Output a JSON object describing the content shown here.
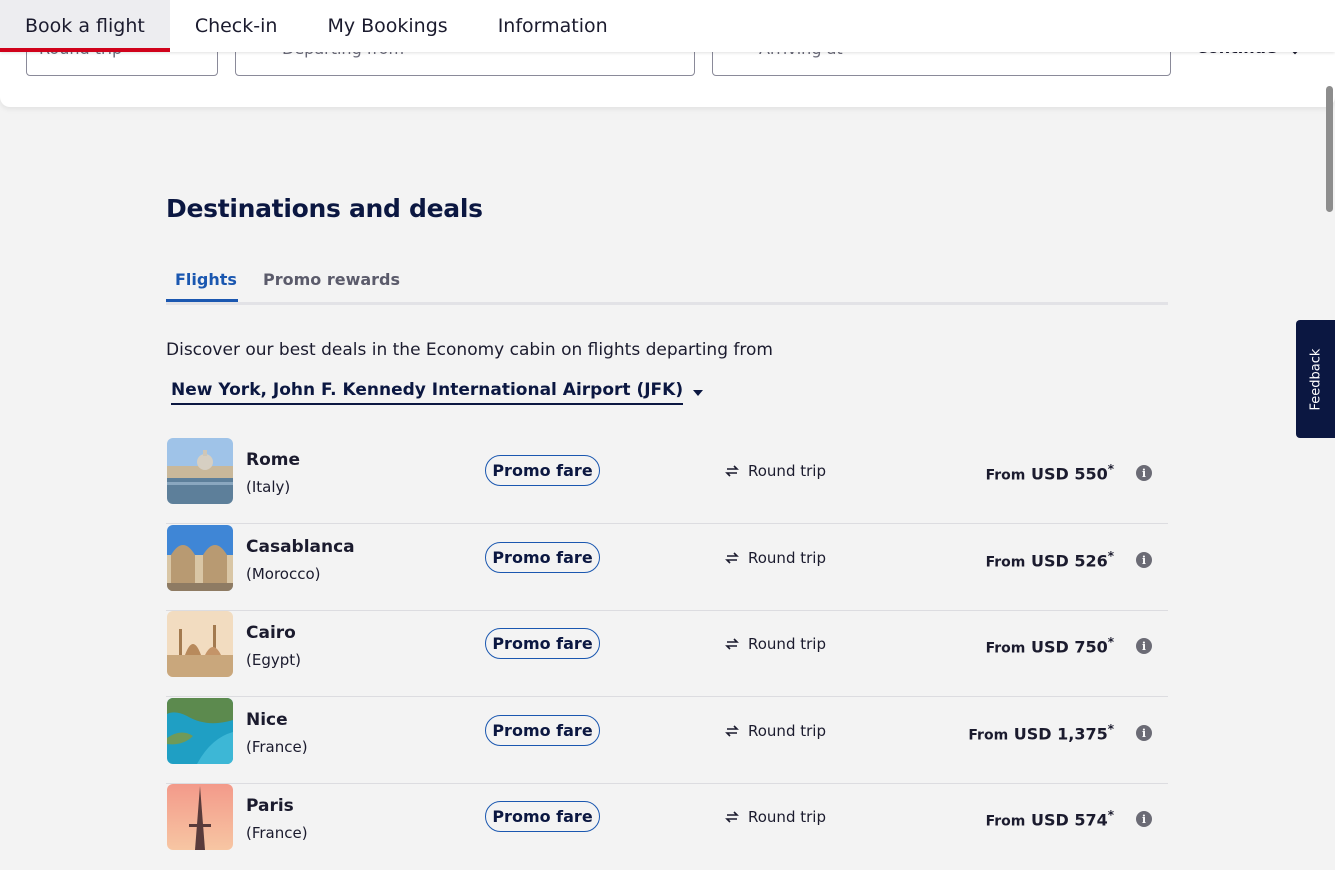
{
  "nav": {
    "tabs": [
      {
        "label": "Book a flight"
      },
      {
        "label": "Check-in"
      },
      {
        "label": "My Bookings"
      },
      {
        "label": "Information"
      }
    ]
  },
  "search": {
    "trip_type": "Round trip",
    "from_placeholder": "Departing from",
    "to_placeholder": "Arriving at",
    "continue_label": "Continue"
  },
  "feedback_label": "Feedback",
  "deals_section": {
    "title": "Destinations and deals",
    "tabs": [
      {
        "label": "Flights"
      },
      {
        "label": "Promo rewards"
      }
    ],
    "intro": "Discover our best deals in the Economy cabin on flights departing from",
    "airport": "New York, John F. Kennedy International Airport (JFK)",
    "deals": [
      {
        "city": "Rome",
        "country": "(Italy)",
        "badge": "Promo fare",
        "trip": "Round trip",
        "from": "From",
        "price": "USD 550",
        "mark": "*"
      },
      {
        "city": "Casablanca",
        "country": "(Morocco)",
        "badge": "Promo fare",
        "trip": "Round trip",
        "from": "From",
        "price": "USD 526",
        "mark": "*"
      },
      {
        "city": "Cairo",
        "country": "(Egypt)",
        "badge": "Promo fare",
        "trip": "Round trip",
        "from": "From",
        "price": "USD 750",
        "mark": "*"
      },
      {
        "city": "Nice",
        "country": "(France)",
        "badge": "Promo fare",
        "trip": "Round trip",
        "from": "From",
        "price": "USD 1,375",
        "mark": "*"
      },
      {
        "city": "Paris",
        "country": "(France)",
        "badge": "Promo fare",
        "trip": "Round trip",
        "from": "From",
        "price": "USD 574",
        "mark": "*"
      }
    ]
  },
  "colors": {
    "accent": "#1a57b0",
    "brand_red": "#d0021b",
    "navy": "#0b1741"
  }
}
